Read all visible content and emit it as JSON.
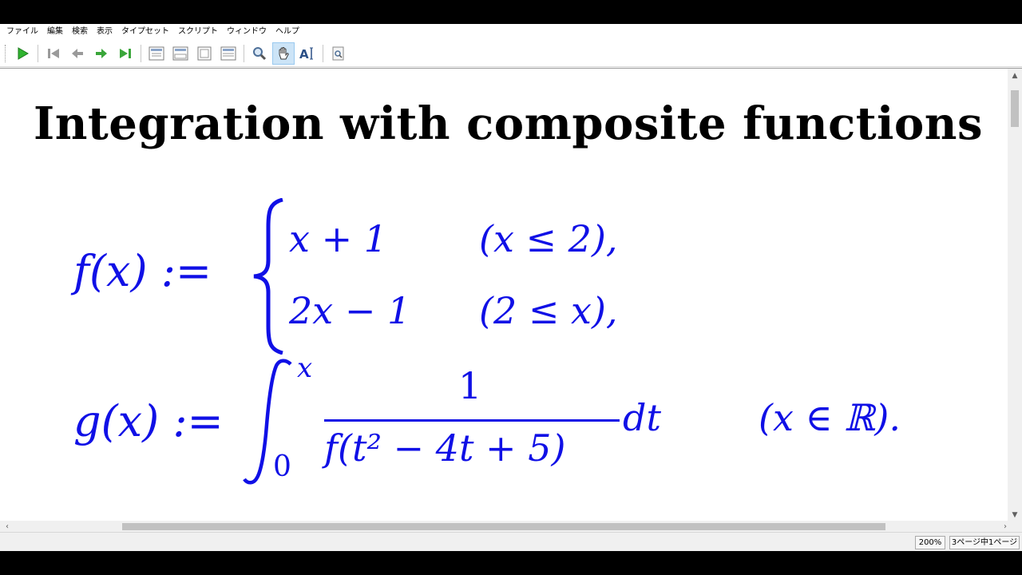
{
  "menu": [
    "ファイル",
    "編集",
    "検索",
    "表示",
    "タイプセット",
    "スクリプト",
    "ウィンドウ",
    "ヘルプ"
  ],
  "toolbar": {
    "icons": [
      "play-icon",
      "first-page-icon",
      "previous-page-icon",
      "next-page-icon",
      "last-page-icon",
      "single-page-icon",
      "continuous-page-icon",
      "facing-pages-icon",
      "fit-width-icon",
      "magnify-icon",
      "hand-icon",
      "select-text-icon",
      "find-icon"
    ],
    "active_tool": "hand-icon",
    "colors": {
      "play": "#2fb32f",
      "nav": "#3aa63a"
    }
  },
  "document": {
    "title": "Integration with composite functions",
    "math_color": "#1010e6",
    "f_lhs": "f(x) :=",
    "case1_expr": "x + 1",
    "case1_cond": "(x ≤ 2),",
    "case2_expr": "2x − 1",
    "case2_cond": "(2 ≤ x),",
    "g_lhs": "g(x) :=",
    "int_upper": "x",
    "int_lower": "0",
    "numerator": "1",
    "denominator": "f(t² − 4t + 5)",
    "differential": "dt",
    "domain": "(x ∈ ℝ)."
  },
  "status": {
    "zoom": "200%",
    "page": "3ページ中1ページ"
  }
}
